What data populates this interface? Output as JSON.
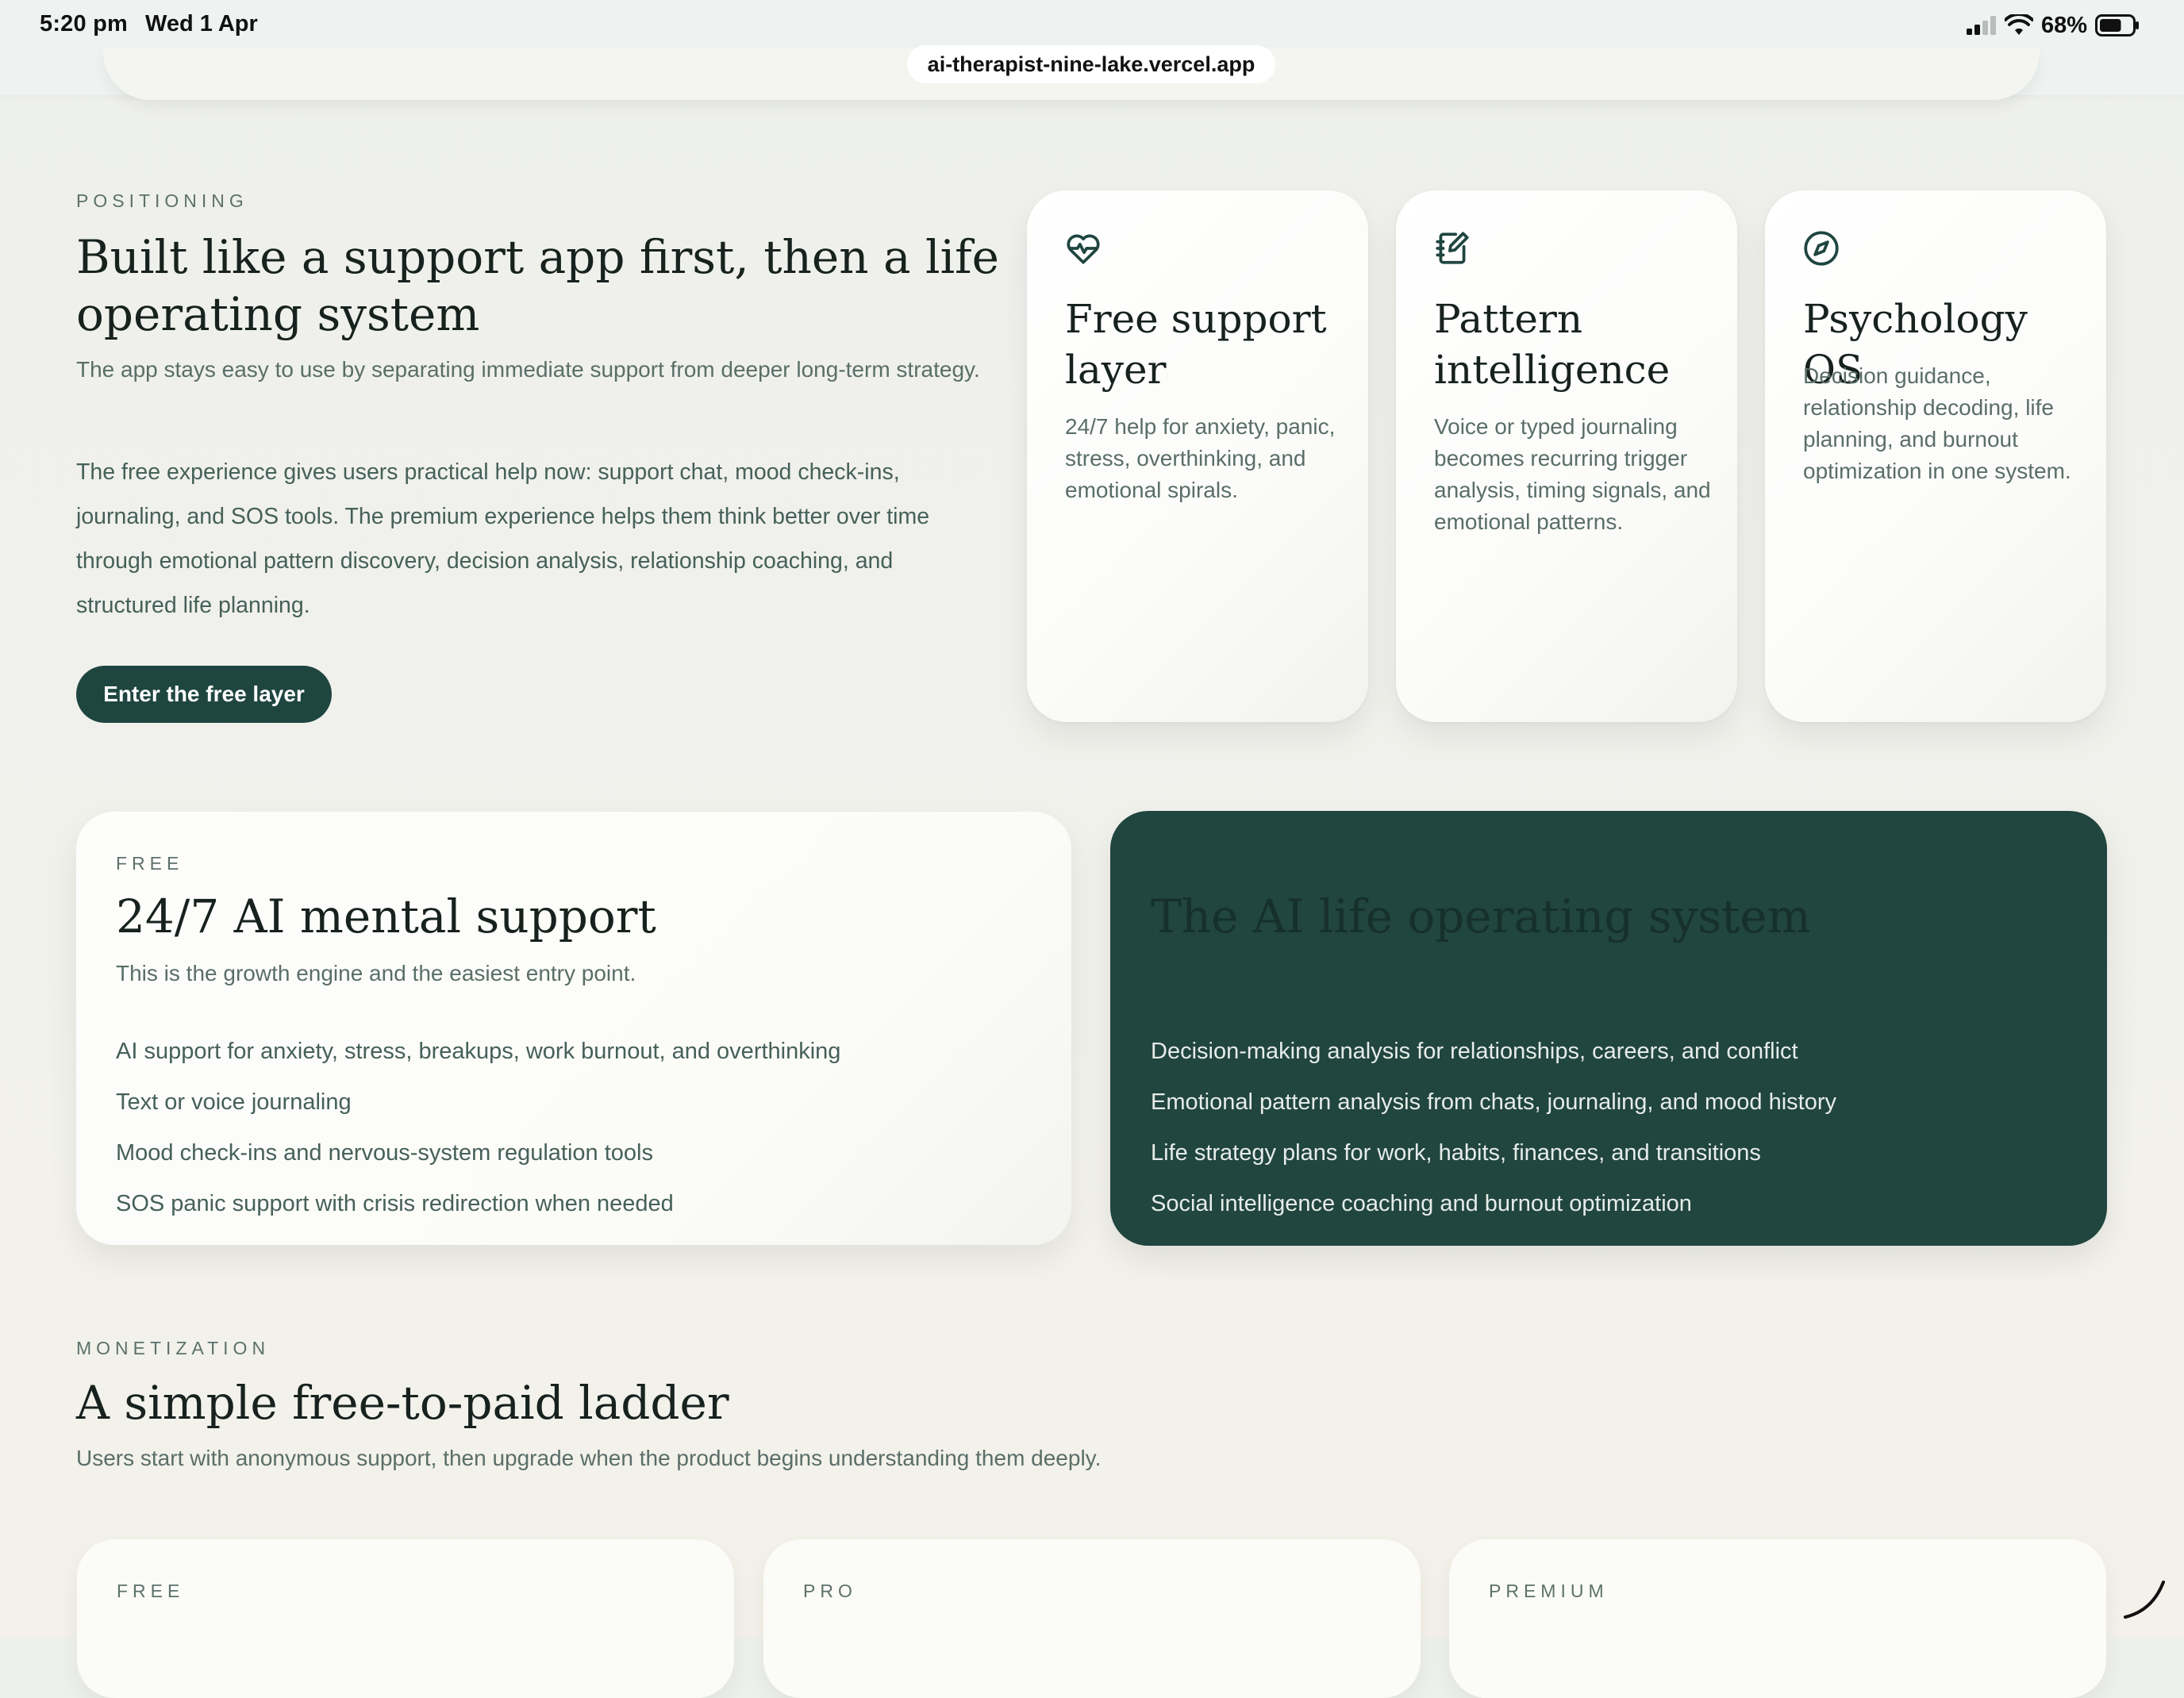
{
  "status_bar": {
    "time": "5:20 pm",
    "date": "Wed 1 Apr",
    "battery_percent": "68%",
    "battery_level": 0.68,
    "url": "ai-therapist-nine-lake.vercel.app"
  },
  "positioning": {
    "eyebrow": "POSITIONING",
    "title": "Built like a support app first, then a life operating system",
    "subtitle": "The app stays easy to use by separating immediate support from deeper long-term strategy.",
    "body": "The free experience gives users practical help now: support chat, mood check-ins, journaling, and SOS tools. The premium experience helps them think better over time through emotional pattern discovery, decision analysis, relationship coaching, and structured life planning.",
    "cta_label": "Enter the free layer"
  },
  "features": [
    {
      "icon": "heart-pulse-icon",
      "title": "Free support layer",
      "text": "24/7 help for anxiety, panic, stress, overthinking, and emotional spirals."
    },
    {
      "icon": "notebook-pen-icon",
      "title": "Pattern intelligence",
      "text": "Voice or typed journaling becomes recurring trigger analysis, timing signals, and emotional patterns."
    },
    {
      "icon": "compass-icon",
      "title": "Psychology OS",
      "text": "Decision guidance, relationship decoding, life planning, and burnout optimization in one system."
    }
  ],
  "free_panel": {
    "eyebrow": "FREE",
    "title": "24/7 AI mental support",
    "subtitle": "This is the growth engine and the easiest entry point.",
    "items": [
      "AI support for anxiety, stress, breakups, work burnout, and overthinking",
      "Text or voice journaling",
      "Mood check-ins and nervous-system regulation tools",
      "SOS panic support with crisis redirection when needed"
    ]
  },
  "premium_panel": {
    "title": "The AI life operating system",
    "items": [
      "Decision-making analysis for relationships, careers, and conflict",
      "Emotional pattern analysis from chats, journaling, and mood history",
      "Life strategy plans for work, habits, finances, and transitions",
      "Social intelligence coaching and burnout optimization"
    ]
  },
  "monetization": {
    "eyebrow": "MONETIZATION",
    "title": "A simple free-to-paid ladder",
    "subtitle": "Users start with anonymous support, then upgrade when the product begins understanding them deeply."
  },
  "pricing": [
    {
      "tier": "FREE"
    },
    {
      "tier": "PRO"
    },
    {
      "tier": "PREMIUM"
    }
  ],
  "colors": {
    "brand_dark_green": "#21453f",
    "button_green": "#1f4540",
    "muted_text": "#5a6e68",
    "heading_text": "#17221f"
  }
}
